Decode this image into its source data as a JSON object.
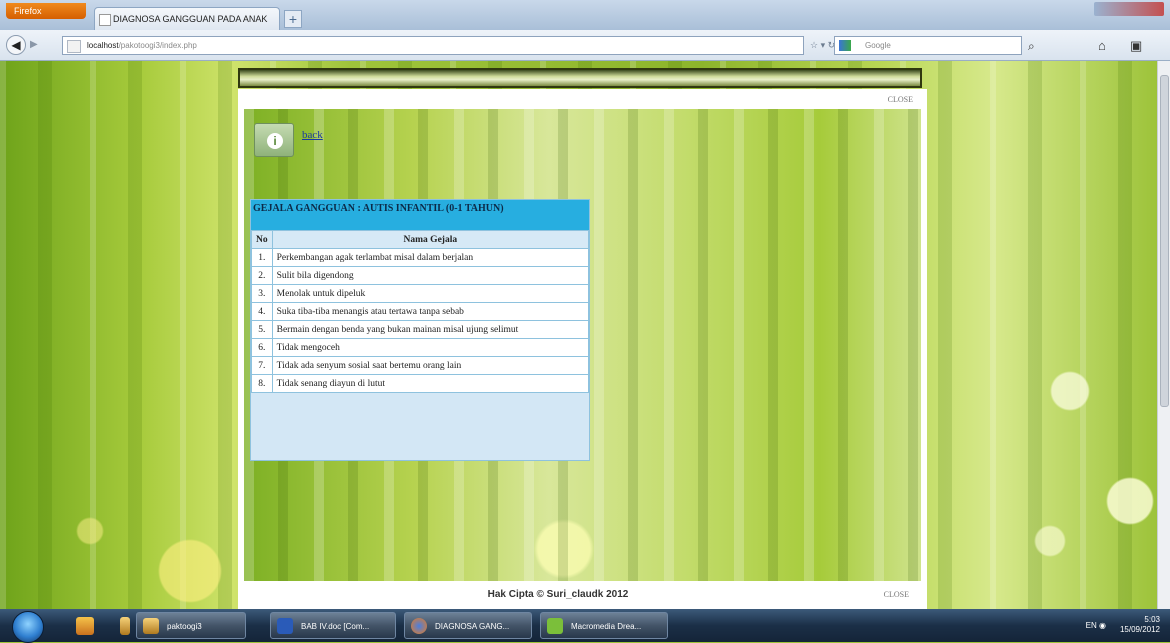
{
  "browser": {
    "app_button": "Firefox",
    "tab_title": "DIAGNOSA GANGGUAN PADA ANAK",
    "new_tab_label": "+",
    "url_host": "localhost",
    "url_path": "/pakotoogi3/index.php",
    "search_placeholder": "Google"
  },
  "page": {
    "close_top": "CLOSE",
    "back_label": "back",
    "panel_title": "GEJALA GANGGUAN : AUTIS INFANTIL (0-1 TAHUN)",
    "table": {
      "headers": [
        "No",
        "Nama Gejala"
      ],
      "rows": [
        {
          "no": "1.",
          "gejala": "Perkembangan agak terlambat misal dalam berjalan"
        },
        {
          "no": "2.",
          "gejala": "Sulit bila digendong"
        },
        {
          "no": "3.",
          "gejala": "Menolak untuk dipeluk"
        },
        {
          "no": "4.",
          "gejala": "Suka tiba-tiba menangis atau tertawa tanpa sebab"
        },
        {
          "no": "5.",
          "gejala": "Bermain dengan benda yang bukan mainan misal ujung selimut"
        },
        {
          "no": "6.",
          "gejala": "Tidak mengoceh"
        },
        {
          "no": "7.",
          "gejala": "Tidak ada senyum sosial saat bertemu orang lain"
        },
        {
          "no": "8.",
          "gejala": "Tidak senang diayun di lutut"
        }
      ]
    },
    "copyright": "Hak Cipta © Suri_claudk 2012",
    "close_bottom": "CLOSE"
  },
  "taskbar": {
    "items": [
      {
        "label": "paktoogi3"
      },
      {
        "label": "BAB IV.doc [Com..."
      },
      {
        "label": "DIAGNOSA GANG..."
      },
      {
        "label": "Macromedia Drea..."
      }
    ],
    "lang": "EN",
    "time": "5:03",
    "date": "15/09/2012"
  },
  "colors": {
    "panel_header": "#27aee0",
    "panel_body": "#d3e7f5",
    "link": "#1a3aa0"
  }
}
